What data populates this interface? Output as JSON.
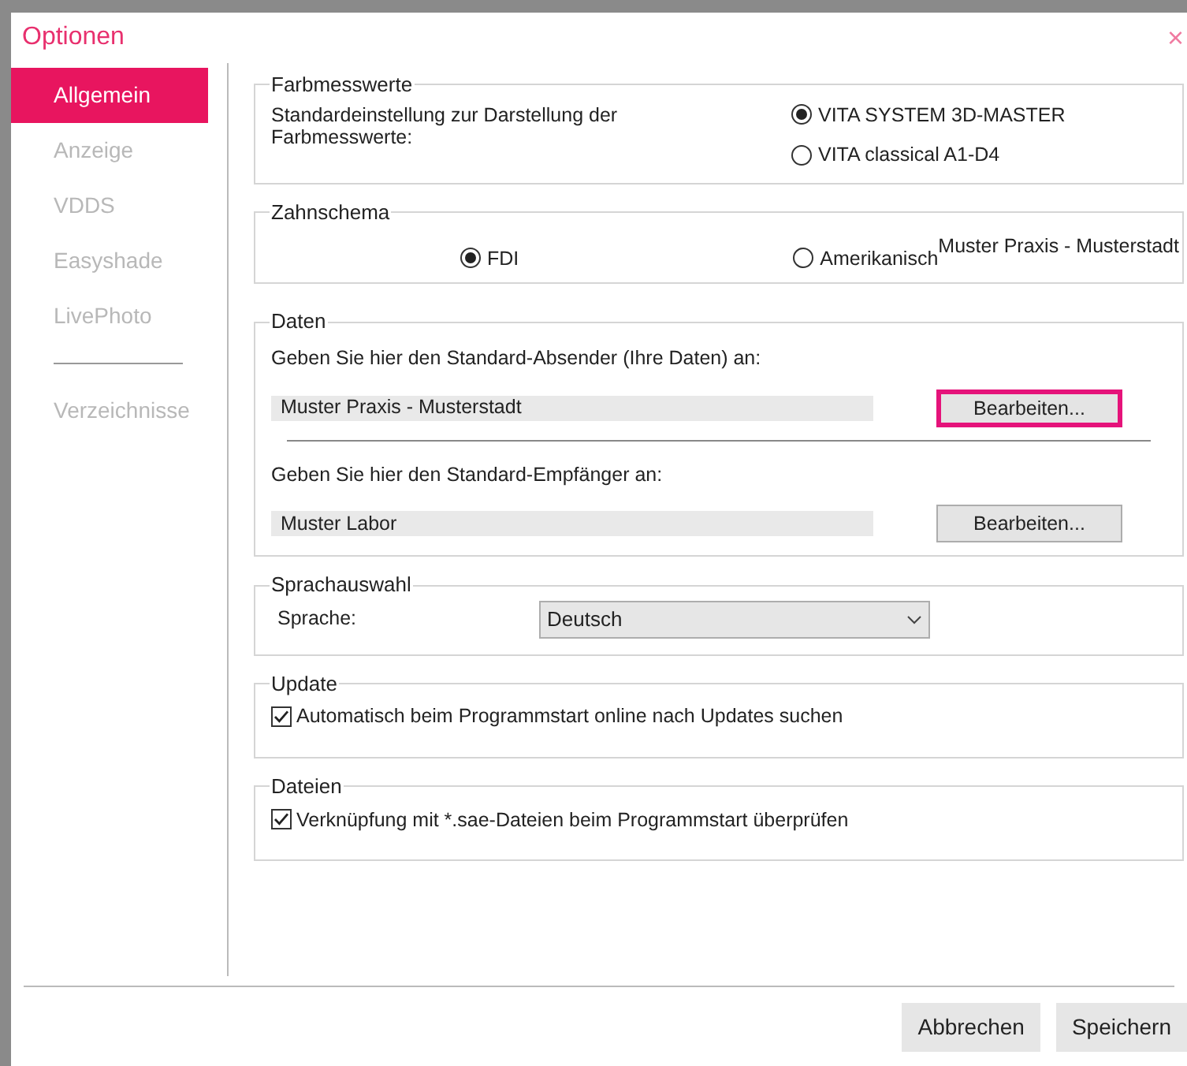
{
  "window": {
    "title": "Optionen",
    "close": "×"
  },
  "sidebar": {
    "groups": [
      [
        {
          "label": "Allgemein",
          "selected": true
        },
        {
          "label": "Anzeige",
          "selected": false
        },
        {
          "label": "VDDS",
          "selected": false
        },
        {
          "label": "Easyshade",
          "selected": false
        },
        {
          "label": "LivePhoto",
          "selected": false
        }
      ],
      [
        {
          "label": "Verzeichnisse",
          "selected": false
        }
      ]
    ]
  },
  "farbmesswerte": {
    "legend": "Farbmesswerte",
    "description": "Standardeinstellung zur Darstellung der Farbmesswerte:",
    "options": [
      {
        "label": "VITA SYSTEM 3D-MASTER",
        "selected": true
      },
      {
        "label": "VITA classical A1-D4",
        "selected": false
      }
    ]
  },
  "zahnschema": {
    "legend": "Zahnschema",
    "overlay_text": "Muster Praxis - Musterstadt",
    "options": [
      {
        "label": "FDI",
        "selected": true
      },
      {
        "label": "Amerikanisch",
        "selected": false
      }
    ]
  },
  "daten": {
    "legend": "Daten",
    "entries": [
      {
        "prompt": "Geben Sie hier den Standard-Absender (Ihre Daten) an:",
        "value": "Muster Praxis - Musterstadt",
        "button": "Bearbeiten...",
        "highlighted": true
      },
      {
        "prompt": "Geben Sie hier den Standard-Empfänger an:",
        "value": "Muster Labor",
        "button": "Bearbeiten...",
        "highlighted": false
      }
    ]
  },
  "sprachauswahl": {
    "legend": "Sprachauswahl",
    "label": "Sprache:",
    "value": "Deutsch"
  },
  "update": {
    "legend": "Update",
    "label": "Automatisch beim Programmstart online nach Updates suchen",
    "checked": true
  },
  "dateien": {
    "legend": "Dateien",
    "label": "Verknüpfung mit *.sae-Dateien beim Programmstart überprüfen",
    "checked": true
  },
  "buttons": [
    "Abbrechen",
    "Speichern"
  ]
}
